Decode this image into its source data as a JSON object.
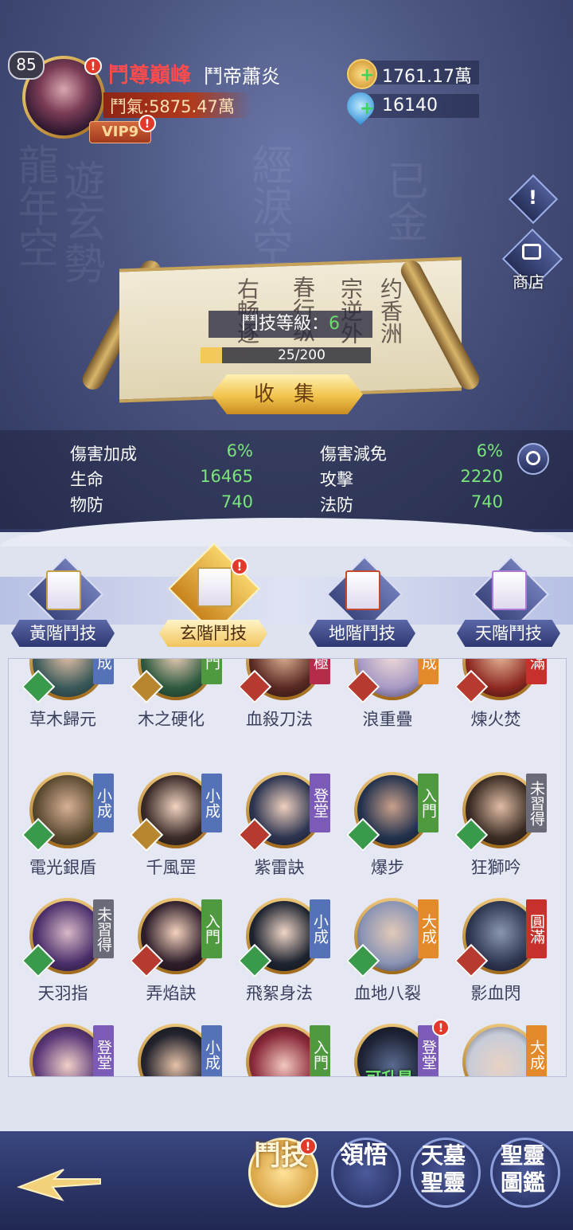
{
  "player": {
    "level": "85",
    "title": "鬥尊巔峰",
    "name": "鬥帝蕭炎",
    "power": "鬥氣:5875.47萬",
    "vip": "VIP9",
    "alert": "!"
  },
  "resources": {
    "gold": "1761.17萬",
    "gems": "16140",
    "plus": "+"
  },
  "side": {
    "notice": "!",
    "shop": "商店"
  },
  "scroll": {
    "level_label": "鬥技等級：",
    "level_value": "6",
    "progress_text": "25/200",
    "progress_fraction": 0.125,
    "collect": "收 集"
  },
  "stats": [
    {
      "label": "傷害加成",
      "value": "6%"
    },
    {
      "label": "傷害減免",
      "value": "6%"
    },
    {
      "label": "生命",
      "value": "16465"
    },
    {
      "label": "攻擊",
      "value": "2220"
    },
    {
      "label": "物防",
      "value": "740"
    },
    {
      "label": "法防",
      "value": "740"
    }
  ],
  "tabs": [
    {
      "label": "黃階鬥技"
    },
    {
      "label": "玄階鬥技"
    },
    {
      "label": "地階鬥技"
    },
    {
      "label": "天階鬥技"
    }
  ],
  "skills": [
    {
      "name": "草木歸元",
      "badge": "小成"
    },
    {
      "name": "木之硬化",
      "badge": "入門"
    },
    {
      "name": "血殺刀法",
      "badge": "無極"
    },
    {
      "name": "浪重疊",
      "badge": "大成"
    },
    {
      "name": "煉火焚",
      "badge": "圓滿"
    },
    {
      "name": "電光銀盾",
      "badge": "小成"
    },
    {
      "name": "千風罡",
      "badge": "小成"
    },
    {
      "name": "紫雷訣",
      "badge": "登堂"
    },
    {
      "name": "爆步",
      "badge": "入門"
    },
    {
      "name": "狂獅吟",
      "badge": "未習得"
    },
    {
      "name": "天羽指",
      "badge": "未習得"
    },
    {
      "name": "弄焰訣",
      "badge": "入門"
    },
    {
      "name": "飛絮身法",
      "badge": "小成"
    },
    {
      "name": "血地八裂",
      "badge": "大成"
    },
    {
      "name": "影血閃",
      "badge": "圓滿"
    },
    {
      "name": "",
      "badge": "登堂"
    },
    {
      "name": "",
      "badge": "小成"
    },
    {
      "name": "",
      "badge": "入門"
    },
    {
      "name": "",
      "badge": "登堂",
      "tag": "可升星"
    },
    {
      "name": "",
      "badge": "大成"
    }
  ],
  "nav": [
    {
      "label": "鬥技"
    },
    {
      "label": "領悟"
    },
    {
      "label": "天墓聖靈"
    },
    {
      "label": "聖靈圖鑑"
    }
  ]
}
